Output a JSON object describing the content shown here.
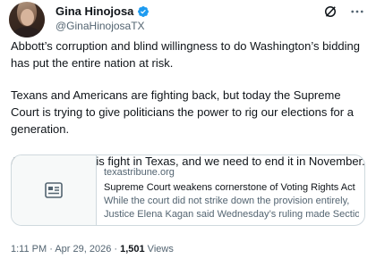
{
  "author": {
    "display_name": "Gina Hinojosa",
    "handle": "@GinaHinojosaTX",
    "avatar": "profile-photo",
    "verified_icon": "verified-badge-icon",
    "verified_color": "#1d9bf0"
  },
  "header_icons": [
    "grok-icon",
    "more-icon"
  ],
  "tweet": {
    "paragraphs": [
      "Abbott’s corruption and blind willingness to do Washington’s bidding has put the entire nation at risk.",
      "Texans and Americans are fighting back, but today the Supreme Court is trying to give politicians the power to rig our elections for a generation.",
      "Abbott started this fight in Texas, and we need to end it in November."
    ]
  },
  "link_card": {
    "icon": "article-icon",
    "domain": "texastribune.org",
    "title": "Supreme Court weakens cornerstone of Voting Rights Act",
    "description_line1": "While the court did not strike down the provision entirely,",
    "description_line2": "Justice Elena Kagan said Wednesday’s ruling made Sectio..."
  },
  "meta": {
    "timestamp": "1:11 PM · Apr 29, 2026 · ",
    "views_count": "1,501",
    "views_label": " Views"
  },
  "colors": {
    "text_primary": "#0f1419",
    "text_secondary": "#536471",
    "border": "#cfd9de"
  }
}
